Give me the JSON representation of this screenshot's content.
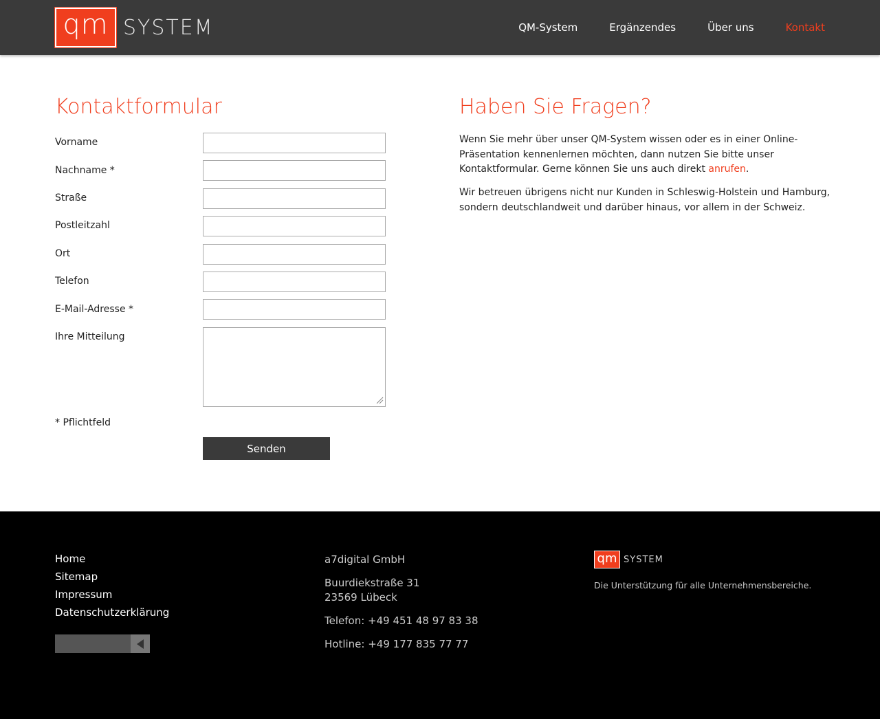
{
  "header": {
    "logo_mark": "qm",
    "logo_text": "SYSTEM",
    "nav": [
      {
        "label": "QM-System"
      },
      {
        "label": "Ergänzendes"
      },
      {
        "label": "Über uns"
      },
      {
        "label": "Kontakt",
        "active": true
      }
    ]
  },
  "form": {
    "title": "Kontaktformular",
    "fields": [
      {
        "label": "Vorname",
        "value": ""
      },
      {
        "label": "Nachname *",
        "value": ""
      },
      {
        "label": "Straße",
        "value": ""
      },
      {
        "label": "Postleitzahl",
        "value": ""
      },
      {
        "label": "Ort",
        "value": ""
      },
      {
        "label": "Telefon",
        "value": ""
      },
      {
        "label": "E-Mail-Adresse *",
        "value": ""
      },
      {
        "label": "Ihre Mitteilung",
        "value": ""
      }
    ],
    "required_note": "* Pflichtfeld",
    "submit_label": "Senden"
  },
  "info": {
    "title": "Haben Sie Fragen?",
    "para1_before": "Wenn Sie mehr über unser QM-System wissen oder es in einer Online-Präsentation kennenlernen möchten, dann nutzen Sie bitte unser Kontaktformular. Gerne können Sie uns auch direkt ",
    "para1_link": "anrufen",
    "para1_after": ".",
    "para2": "Wir betreuen übrigens nicht nur Kunden in Schleswig-Holstein und Hamburg, sondern deutschlandweit und darüber hinaus, vor allem in der Schweiz."
  },
  "footer": {
    "links": [
      "Home",
      "Sitemap",
      "Impressum",
      "Datenschutzerklärung"
    ],
    "company": "a7digital GmbH",
    "street": "Buurdiekstraße 31",
    "city": "23569 Lübeck",
    "phone": "Telefon: +49 451 48 97 83 38",
    "hotline": "Hotline: +49 177 835 77 77",
    "logo_mark": "qm",
    "logo_text": "SYSTEM",
    "tagline": "Die Unterstützung für alle Unternehmensbereiche."
  },
  "colors": {
    "accent": "#f03e1e",
    "header_bg": "#3a3a3a",
    "footer_bg": "#000000"
  }
}
